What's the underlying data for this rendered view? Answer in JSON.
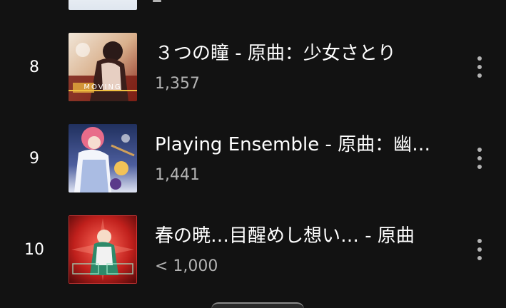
{
  "top_partial_row": {
    "plays": "–"
  },
  "tracks": [
    {
      "number": "8",
      "title": "３つの瞳 - 原曲：少女さとり",
      "plays": "1,357",
      "cover_icon": "album-cover-art",
      "cover_text": "MOVING"
    },
    {
      "number": "9",
      "title": "Playing Ensemble - 原曲：幽霊楽団",
      "plays": "1,441",
      "cover_icon": "album-cover-art"
    },
    {
      "number": "10",
      "title": "春の暁…目醒めし想い… - 原曲",
      "plays": "< 1,000",
      "cover_icon": "album-cover-art"
    }
  ],
  "more_icon": "more-vertical-icon",
  "colors": {
    "background": "#121212",
    "primary_text": "#ffffff",
    "secondary_text": "#b3b3b3"
  }
}
